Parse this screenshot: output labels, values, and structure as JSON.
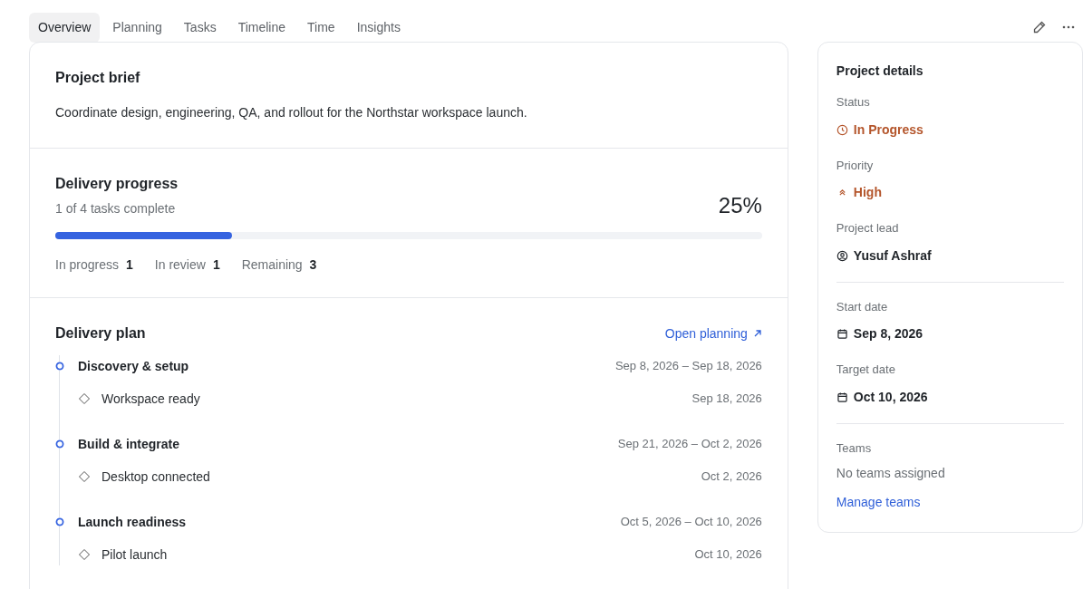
{
  "tabs": [
    {
      "label": "Overview",
      "selected": true
    },
    {
      "label": "Planning",
      "selected": false
    },
    {
      "label": "Tasks",
      "selected": false
    },
    {
      "label": "Timeline",
      "selected": false
    },
    {
      "label": "Time",
      "selected": false
    },
    {
      "label": "Insights",
      "selected": false
    }
  ],
  "brief": {
    "title": "Project brief",
    "text": "Coordinate design, engineering, QA, and rollout for the Northstar workspace launch."
  },
  "progress": {
    "title": "Delivery progress",
    "subtitle": "1 of 4 tasks complete",
    "percent": "25%",
    "level": 0.25,
    "stats": [
      {
        "label": "In progress",
        "value": "1"
      },
      {
        "label": "In review",
        "value": "1"
      },
      {
        "label": "Remaining",
        "value": "3"
      }
    ]
  },
  "plan": {
    "title": "Delivery plan",
    "link": "Open planning",
    "phases": [
      {
        "name": "Discovery & setup",
        "dates": "Sep 8, 2026 – Sep 18, 2026",
        "milestones": [
          {
            "name": "Workspace ready",
            "date": "Sep 18, 2026"
          }
        ]
      },
      {
        "name": "Build & integrate",
        "dates": "Sep 21, 2026 – Oct 2, 2026",
        "milestones": [
          {
            "name": "Desktop connected",
            "date": "Oct 2, 2026"
          }
        ]
      },
      {
        "name": "Launch readiness",
        "dates": "Oct 5, 2026 – Oct 10, 2026",
        "milestones": [
          {
            "name": "Pilot launch",
            "date": "Oct 10, 2026"
          }
        ]
      }
    ]
  },
  "details": {
    "title": "Project details",
    "groups": [
      [
        {
          "label": "Status",
          "value": "In Progress",
          "kind": "status"
        },
        {
          "label": "Priority",
          "value": "High",
          "kind": "priority"
        },
        {
          "label": "Project lead",
          "value": "Yusuf Ashraf",
          "kind": "person"
        }
      ],
      [
        {
          "label": "Start date",
          "value": "Sep 8, 2026",
          "kind": "date"
        },
        {
          "label": "Target date",
          "value": "Oct 10, 2026",
          "kind": "date"
        }
      ]
    ],
    "teams": {
      "label": "Teams",
      "empty": "No teams assigned",
      "link": "Manage teams"
    }
  }
}
